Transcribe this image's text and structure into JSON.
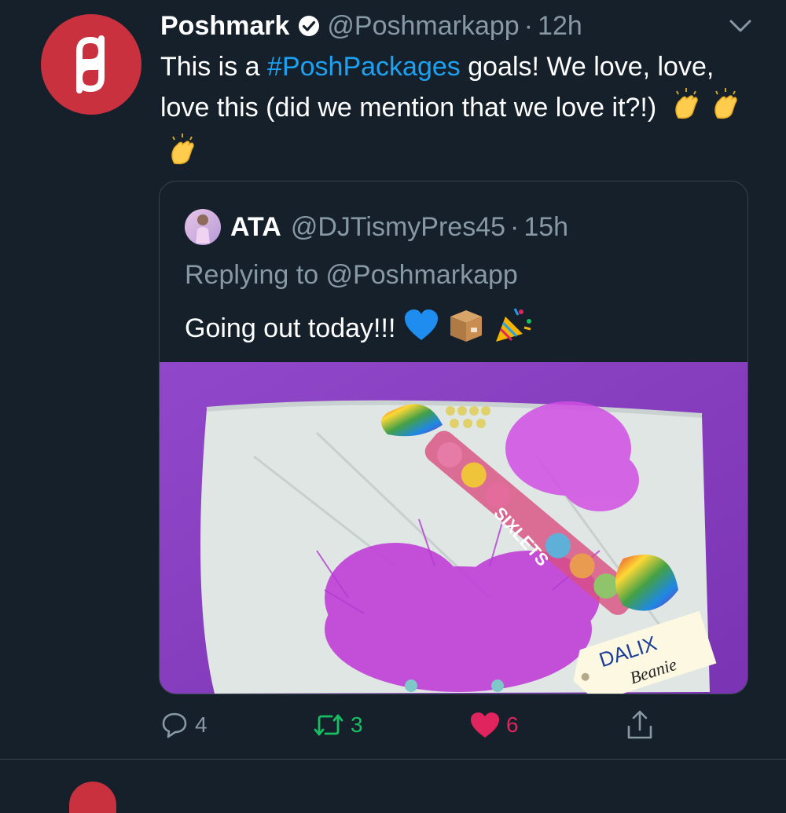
{
  "tweet": {
    "author": {
      "name": "Poshmark",
      "handle": "@Poshmarkapp",
      "separator": "·",
      "time": "12h",
      "verified": true
    },
    "text_before": "This is a ",
    "hashtag": "#PoshPackages",
    "text_after": " goals! We love, love, love this (did we mention that we love it?!)",
    "emojis": [
      "clapping-hands",
      "clapping-hands",
      "clapping-hands"
    ]
  },
  "quote": {
    "author": {
      "name": "ATA",
      "handle": "@DJTismyPres45",
      "separator": "·",
      "time": "15h"
    },
    "replying_to": "Replying to @Poshmarkapp",
    "text": "Going out today!!!",
    "emojis": [
      "blue-heart",
      "package",
      "party-popper"
    ],
    "image": {
      "description_labels": [
        "SIXLETS",
        "DALIX",
        "Beanie"
      ]
    }
  },
  "actions": {
    "reply_count": "4",
    "retweet_count": "3",
    "like_count": "6"
  },
  "colors": {
    "background": "#15202b",
    "link": "#1da1f2",
    "secondary_text": "#8899a6",
    "retweet": "#17bf63",
    "like": "#e0245e",
    "brand": "#c9313e"
  }
}
